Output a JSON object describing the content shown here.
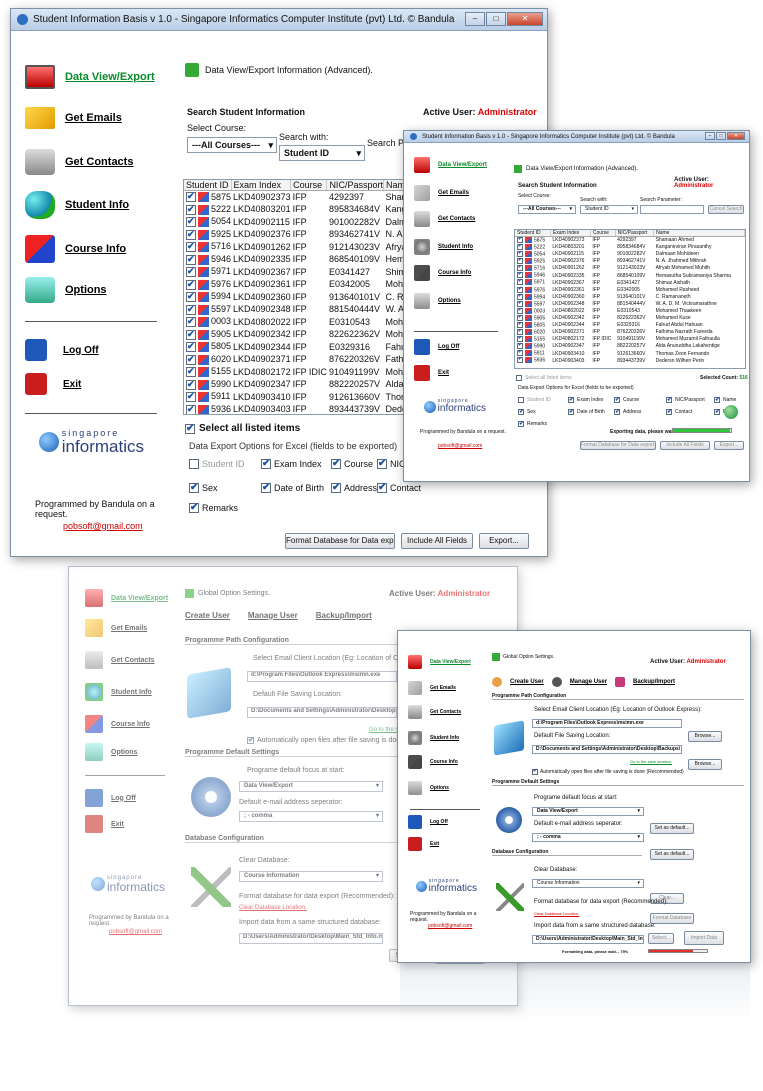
{
  "app_title": "Student Information Basis v 1.0 - Singapore Informatics Computer Institute (pvt) Ltd. © Bandula",
  "nav": [
    {
      "label": "Data View/Export",
      "icon": "monitor-icon"
    },
    {
      "label": "Get Emails",
      "icon": "envelope-icon"
    },
    {
      "label": "Get Contacts",
      "icon": "phone-icon"
    },
    {
      "label": "Student Info",
      "icon": "people-icon"
    },
    {
      "label": "Course Info",
      "icon": "shapes-icon"
    },
    {
      "label": "Options",
      "icon": "options-icon"
    },
    {
      "label": "Log Off",
      "icon": "lock-icon"
    },
    {
      "label": "Exit",
      "icon": "power-icon"
    }
  ],
  "branding": {
    "logo_top": "singapore",
    "logo_main": "informatics",
    "programmed_by": "Programmed by Bandula on a request.",
    "email": "pobsoft@gmail.com"
  },
  "dataview": {
    "header": "Data View/Export Information (Advanced).",
    "search_title": "Search Student Information",
    "active_user_label": "Active User:",
    "active_user": "Administrator",
    "select_course_label": "Select Course:",
    "course_value": "---All Courses---",
    "search_with_label": "Search with:",
    "search_with_value": "Student ID",
    "search_param_label": "Search Parameter:",
    "cancel_search": "Cancel Search",
    "columns": [
      "Student ID",
      "Exam Index",
      "Course",
      "NIC/Passport",
      "Name"
    ],
    "rows": [
      [
        "5875",
        "LKD40902373",
        "IFP",
        "4292397",
        "Shamaan Ahmed"
      ],
      [
        "5222",
        "LKD40803201",
        "IFP",
        "895834684V",
        "Kanganirviran Pirasanthy"
      ],
      [
        "5054",
        "LKD40902115",
        "IFP",
        "901002282V",
        "Dalmaan Mohideen"
      ],
      [
        "5925",
        "LKD40902376",
        "IFP",
        "893462741V",
        "N. A. Jhahmed Mithrah"
      ],
      [
        "5716",
        "LKD40901262",
        "IFP",
        "912143023V",
        "Afryab Mohamed Muhith"
      ],
      [
        "5946",
        "LKD40902335",
        "IFP",
        "868540109V",
        "Hemasutha Subramaniya Sharma"
      ],
      [
        "5971",
        "LKD40902367",
        "IFP",
        "E0341427",
        "Shimaz Aishath"
      ],
      [
        "5976",
        "LKD40902361",
        "IFP",
        "E0342005",
        "Mohamed Rasheed"
      ],
      [
        "5994",
        "LKD40902360",
        "IFP",
        "913640101V",
        "C. Ramananeth"
      ],
      [
        "5597",
        "LKD40902348",
        "IFP",
        "881540444V",
        "W. A. D. M. Vickramarathne"
      ],
      [
        "0003",
        "LKD40802022",
        "IFP",
        "E0310543",
        "Mohamed Thaakeen"
      ],
      [
        "5905",
        "LKD40902342",
        "IFP",
        "822622362V",
        "Mohamed Kuse"
      ],
      [
        "5805",
        "LKD40902344",
        "IFP",
        "E0329316",
        "Fahud Abdul Hahuan"
      ],
      [
        "6020",
        "LKD40902371",
        "IFP",
        "876220326V",
        "Fathima Nazrath Fareeda"
      ],
      [
        "5155",
        "LKD40802172",
        "IFP IDIC",
        "910491199V",
        "Mohamed Muzamil Fathaulla"
      ],
      [
        "5990",
        "LKD40902347",
        "IFP",
        "882220257V",
        "Alda Anuruddha Lakahentige"
      ],
      [
        "5911",
        "LKD40903410",
        "IFP",
        "912613660V",
        "Thomas Zeon Fernando"
      ],
      [
        "5936",
        "LKD40903403",
        "IFP",
        "893443739V",
        "Dedersn Wilhen Perin"
      ]
    ],
    "select_all": "Select all listed items",
    "selected_count_label": "Selected Count:",
    "selected_count": "516",
    "export_options_label": "Data Export Options for Excel (fields to be exported)",
    "export_fields": [
      {
        "label": "Student ID",
        "checked": false
      },
      {
        "label": "Exam Index",
        "checked": true
      },
      {
        "label": "Course",
        "checked": true
      },
      {
        "label": "NIC/Passport",
        "checked": true
      },
      {
        "label": "Name",
        "checked": true
      },
      {
        "label": "Sex",
        "checked": true
      },
      {
        "label": "Date of Birth",
        "checked": true
      },
      {
        "label": "Address",
        "checked": true
      },
      {
        "label": "Contact",
        "checked": true
      },
      {
        "label": "Email",
        "checked": true
      },
      {
        "label": "Remarks",
        "checked": true
      }
    ],
    "exporting_msg": "Exporting data, please wait... 98%",
    "export_progress": 0.98,
    "btn_format": "Format Database for Data export...",
    "btn_include_all": "Include All Fields",
    "btn_export": "Export..."
  },
  "options": {
    "header": "Global Option Settings.",
    "active_user_label": "Active User:",
    "active_user": "Administrator",
    "tabs": [
      "Create User",
      "Manage User",
      "Backup/Import"
    ],
    "path_section": "Programme Path Configuration",
    "email_client_label": "Select Email Client Location (Eg: Location of Outlook Express):",
    "email_client_value": "d:\\Program Files\\Outlook Express\\msimn.exe",
    "save_location_label": "Default File Saving Location:",
    "save_location_value": "D:\\Documents and Settings\\Administrator\\Desktop\\Backups\\",
    "goto_location": "Go to the save location.",
    "browse": "Browse...",
    "auto_open": "Automatically open files after file saving is done (Recommended)",
    "defaults_section": "Programme Default Settings",
    "focus_label": "Programe default focus at start:",
    "focus_value": "Data View/Export",
    "separator_label": "Default e-mail address seperator:",
    "separator_value": "; - comma",
    "set_default": "Set as default...",
    "db_section": "Database Configuration",
    "clear_db_label": "Clear Database:",
    "clear_db_value": "Course Information",
    "clear_btn": "Clear...",
    "format_label": "Format database for data export (Recommended):",
    "clear_db_location": "Clear Database Location.",
    "format_btn": "Format Database",
    "import_label": "Import data from a same structured database:",
    "import_path": "D:\\Users\\Administrator\\Desktop\\Main_Std_Info.mdb",
    "select_btn": "Select...",
    "import_btn": "Import Data",
    "formatting_msg": "Formatting data, please wait... 75%",
    "format_progress": 0.75
  },
  "colors": {
    "accent_green": "#0a8a2a",
    "active_red": "#d00000",
    "progress_green": "#2fc43a",
    "progress_red": "#e53030"
  }
}
